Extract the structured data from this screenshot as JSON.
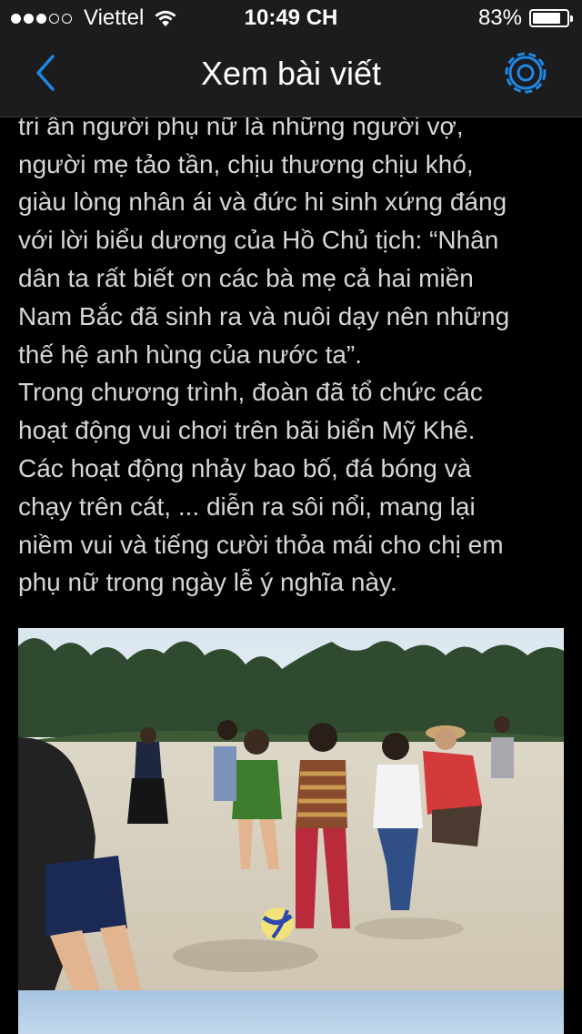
{
  "status_bar": {
    "signal_dots": [
      true,
      true,
      true,
      false,
      false
    ],
    "carrier": "Viettel",
    "time": "10:49 CH",
    "battery_percent": "83%",
    "battery_level": 0.83
  },
  "nav": {
    "title": "Xem bài viết",
    "back_icon": "chevron-left-icon",
    "settings_icon": "gear-icon",
    "accent_color": "#1e88e5"
  },
  "article": {
    "paragraphs": [
      "Trưởng ban Nữ công phát biểu cảm nghĩ và\ntri ân người phụ nữ là những người vợ,\nngười mẹ tảo tần, chịu thương chịu khó,\ngiàu lòng nhân ái và đức hi sinh xứng đáng\nvới lời biểu dương của Hồ Chủ tịch: “Nhân\ndân ta rất biết ơn các bà mẹ cả hai miền\nNam Bắc đã sinh ra và nuôi dạy nên những\nthế hệ anh hùng của nước ta”.",
      "Trong chương trình, đoàn đã tổ chức các\nhoạt động vui chơi trên bãi biển Mỹ Khê.\nCác hoạt động nhảy bao bố, đá bóng và\nchạy trên cát, ... diễn ra sôi nổi, mang lại\nniềm vui và tiếng cười thỏa mái cho chị em\nphụ nữ trong ngày lễ ý nghĩa này."
    ]
  }
}
